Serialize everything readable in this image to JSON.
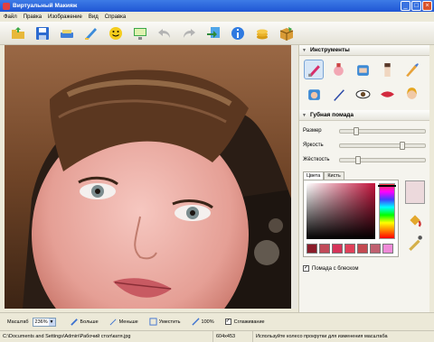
{
  "window": {
    "title": "Виртуальный Макияж"
  },
  "menu": [
    "Файл",
    "Правка",
    "Изображение",
    "Вид",
    "Справка"
  ],
  "toolbar_icons": [
    "open-folder-icon",
    "save-icon",
    "scanner-icon",
    "paint-icon",
    "smiley-icon",
    "monitor-icon",
    "undo-icon",
    "redo-icon",
    "export-icon",
    "info-icon",
    "coins-icon",
    "box-icon"
  ],
  "sidebar": {
    "tools_title": "Инструменты",
    "tool_icons": [
      "lipstick-icon",
      "blush-icon",
      "foundation-icon",
      "concealer-icon",
      "brush-icon",
      "powder-icon",
      "eyeliner-icon",
      "eye-icon",
      "lips-icon",
      "hair-icon"
    ],
    "section_title": "Губная помада",
    "sliders": [
      {
        "label": "Размер",
        "value": 0.18
      },
      {
        "label": "Яркость",
        "value": 0.72
      },
      {
        "label": "Жёсткость",
        "value": 0.2
      }
    ],
    "tabs": [
      "Цвета",
      "Кисть"
    ],
    "active_tab": "Цвета",
    "swatch_colors": [
      "#8a1c2a",
      "#c14b5a",
      "#d6345a",
      "#e0405a",
      "#c44a52",
      "#c06070",
      "#ee8ad8"
    ],
    "preview_color": "#ecd9dc",
    "gloss_label": "Помада с блеском",
    "gloss_checked": true
  },
  "bottom": {
    "zoom_label": "Масштаб",
    "zoom_value": "236%",
    "bigger": "Больше",
    "smaller": "Меньше",
    "fit": "Уместить",
    "actual": "100%",
    "smoothing": "Сглаживание",
    "smoothing_checked": true
  },
  "status": {
    "path": "C:\\Documents and Settings\\Admin\\Рабочий стол\\катя.jpg",
    "size": "604x453",
    "hint": "Используйте колесо прокрутки для изменения масштаба"
  }
}
